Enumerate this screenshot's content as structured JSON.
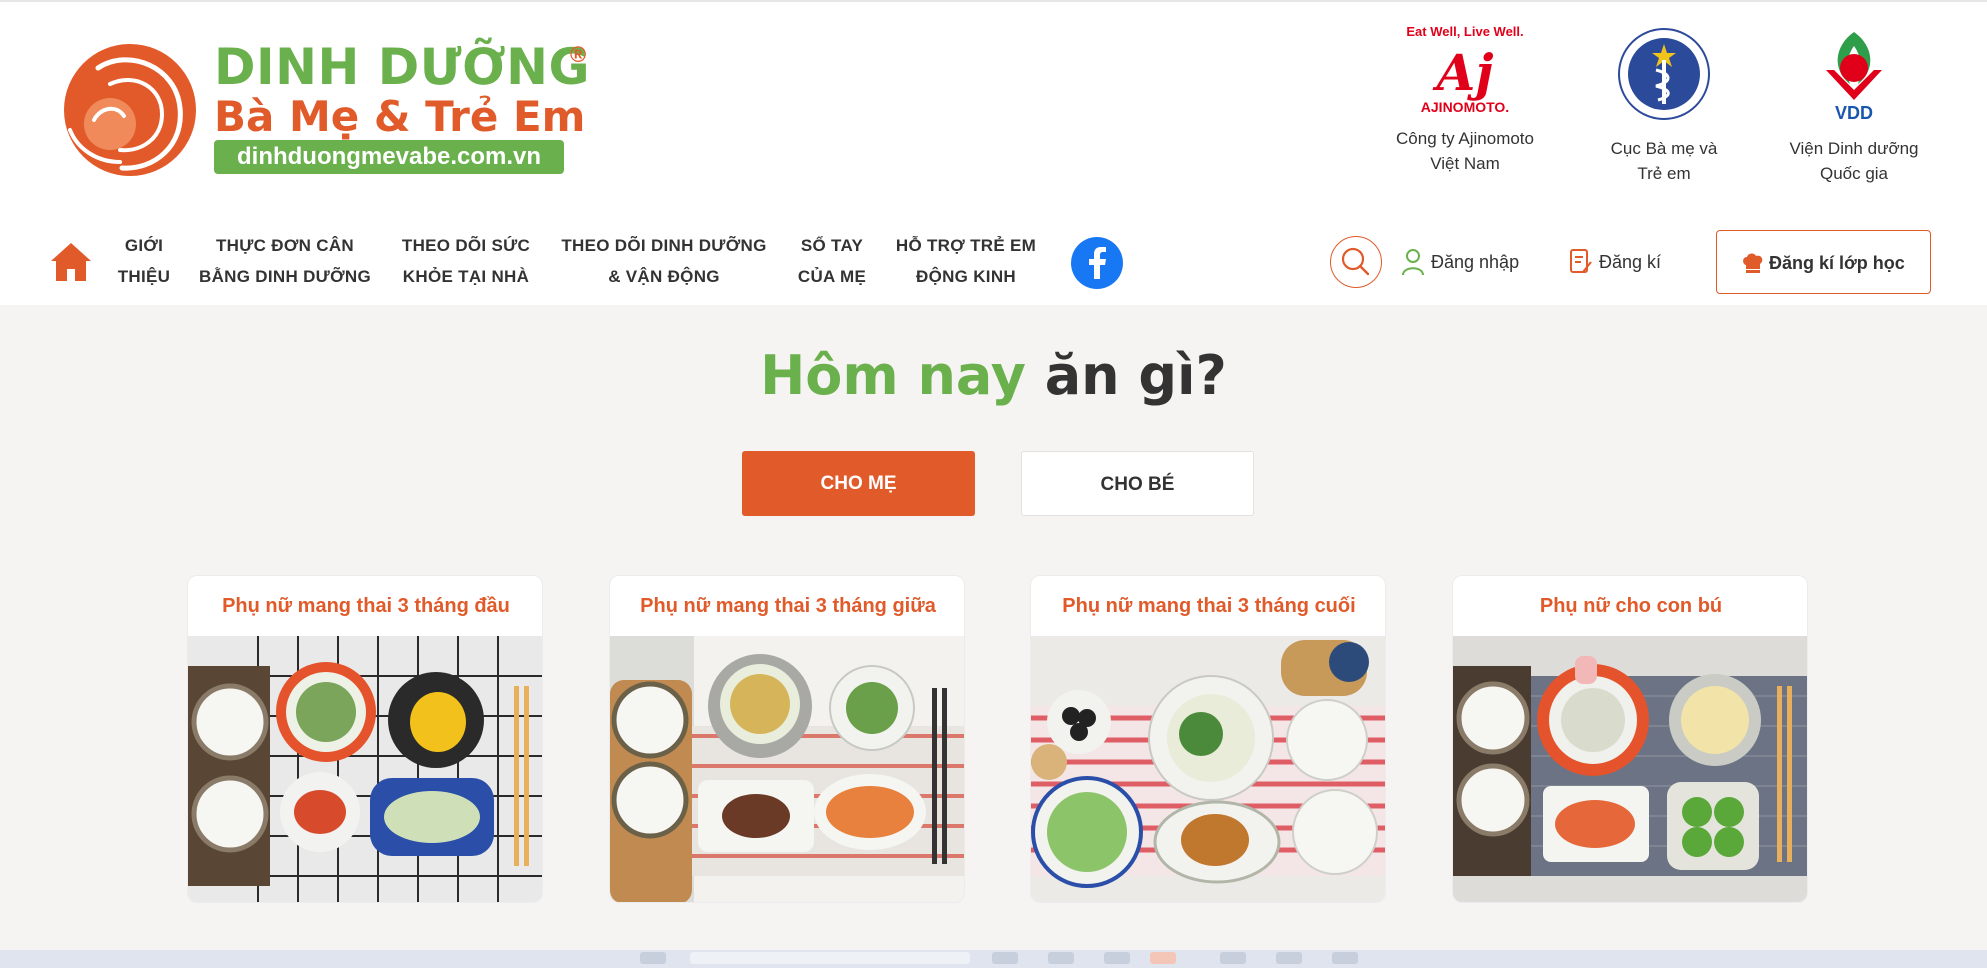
{
  "brand": {
    "line1": "DINH DƯỠNG",
    "registered": "®",
    "line2": "Bà Mẹ & Trẻ Em",
    "url": "dinhduongmevabe.com.vn",
    "colors": {
      "green": "#6ab04c",
      "orange": "#e05a2a"
    }
  },
  "partners": [
    {
      "tagline": "Eat Well, Live Well.",
      "wordmark": "AJINOMOTO.",
      "name_line1": "Công ty Ajinomoto",
      "name_line2": "Việt Nam",
      "icon": "ajinomoto-logo"
    },
    {
      "name_line1": "Cục Bà mẹ và",
      "name_line2": "Trẻ em",
      "icon": "ministry-of-health-seal"
    },
    {
      "wordmark": "VDD",
      "name_line1": "Viện Dinh dưỡng",
      "name_line2": "Quốc gia",
      "icon": "vdd-logo"
    }
  ],
  "nav": {
    "home_icon": "home-icon",
    "items": [
      {
        "line1": "GIỚI",
        "line2": "THIỆU"
      },
      {
        "line1": "THỰC ĐƠN CÂN",
        "line2": "BẰNG DINH DƯỠNG"
      },
      {
        "line1": "THEO DÕI SỨC",
        "line2": "KHỎE TẠI NHÀ"
      },
      {
        "line1": "THEO DÕI DINH DƯỠNG",
        "line2": "& VẬN ĐỘNG"
      },
      {
        "line1": "SỔ TAY",
        "line2": "CỦA MẸ"
      },
      {
        "line1": "HỖ TRỢ TRẺ EM",
        "line2": "ĐỘNG KINH"
      }
    ],
    "facebook_icon": "facebook-icon",
    "search_icon": "search-icon",
    "login_label": "Đăng nhập",
    "register_label": "Đăng kí",
    "class_button_label": "Đăng kí lớp học"
  },
  "main": {
    "title_part1": "Hôm nay",
    "title_part2": "ăn gì?",
    "tabs": [
      {
        "label": "CHO MẸ",
        "active": true
      },
      {
        "label": "CHO BÉ",
        "active": false
      }
    ],
    "cards": [
      {
        "title": "Phụ nữ mang thai 3 tháng đầu"
      },
      {
        "title": "Phụ nữ mang thai 3 tháng giữa"
      },
      {
        "title": "Phụ nữ mang thai 3 tháng cuối"
      },
      {
        "title": "Phụ nữ cho con bú"
      }
    ]
  }
}
